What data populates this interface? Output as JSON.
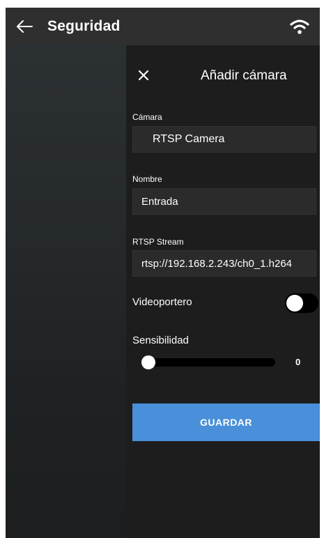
{
  "header": {
    "back_icon": "arrow-left-icon",
    "title": "Seguridad",
    "status_icon": "wifi-icon"
  },
  "panel": {
    "close_icon": "close-icon",
    "title": "Añadir cámara",
    "camera": {
      "label": "Cámara",
      "value": "RTSP Camera"
    },
    "name": {
      "label": "Nombre",
      "value": "Entrada"
    },
    "stream": {
      "label": "RTSP Stream",
      "value": "rtsp://192.168.2.243/ch0_1.h264"
    },
    "doorbell": {
      "label": "Videoportero",
      "enabled": false
    },
    "sensitivity": {
      "label": "Sensibilidad",
      "value": 0,
      "value_text": "0",
      "min": 0,
      "max": 100
    },
    "save_label": "GUARDAR"
  },
  "colors": {
    "topbar": "#2f2f2f",
    "panel": "#1d1d1d",
    "field": "#2b2b2b",
    "accent": "#4a8fd9",
    "track": "#000000"
  }
}
